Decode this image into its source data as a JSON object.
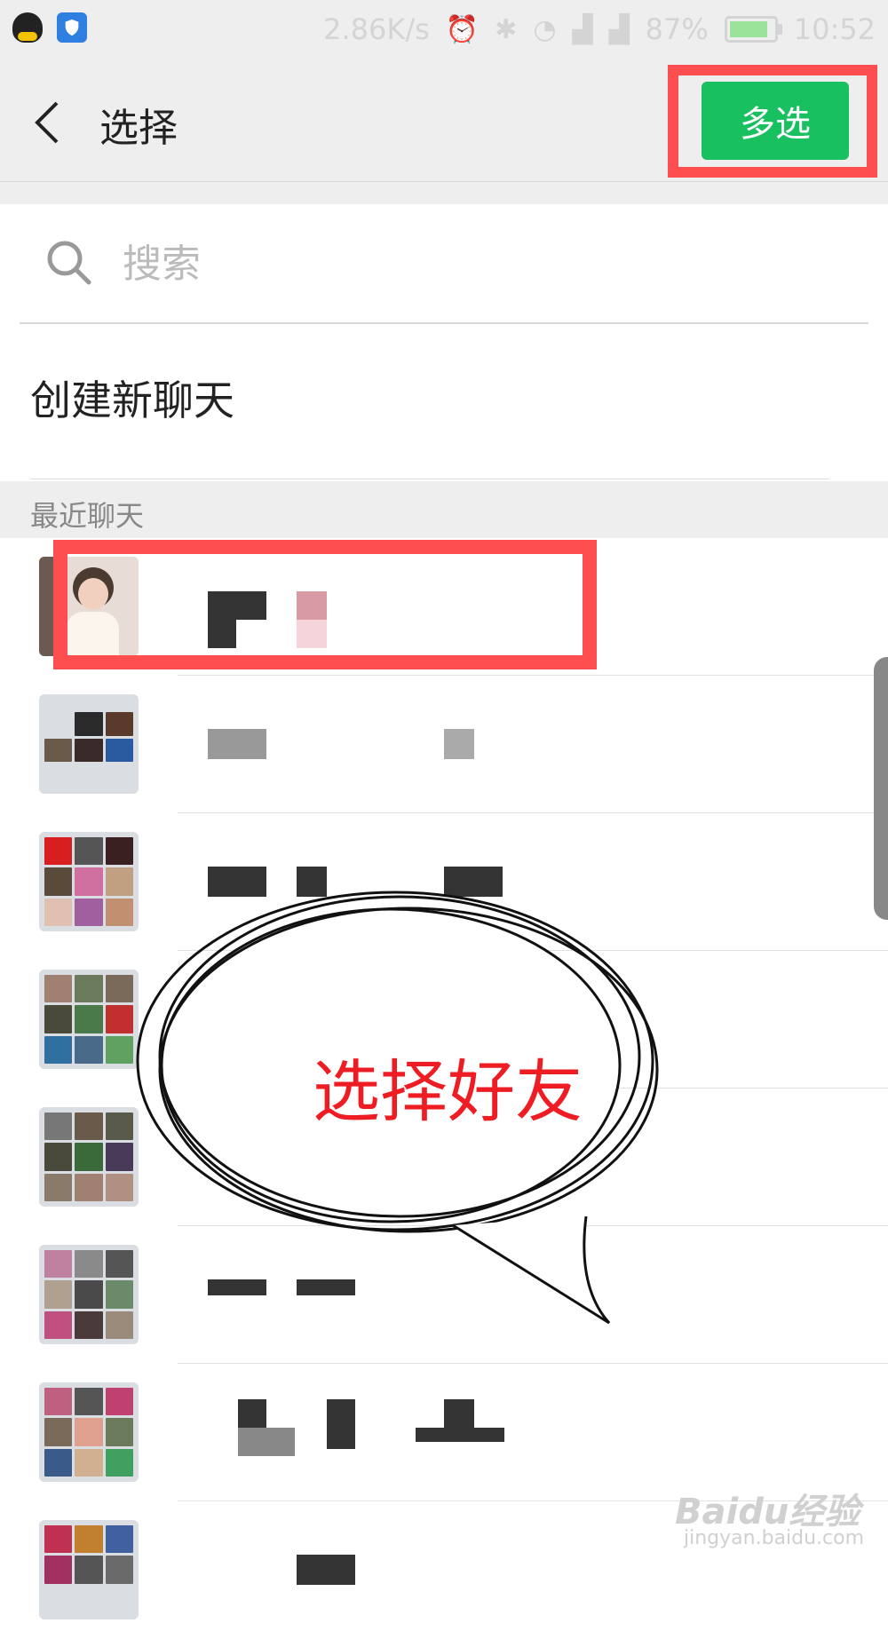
{
  "status_bar": {
    "speed": "2.86K/s",
    "battery_pct": "87%",
    "time": "10:52",
    "icons": [
      "qq-app-icon",
      "shield-app-icon",
      "alarm-icon",
      "bluetooth-icon",
      "wifi-icon",
      "signal-icon",
      "signal-icon",
      "battery-icon"
    ]
  },
  "header": {
    "title": "选择",
    "multi_select": "多选"
  },
  "search": {
    "placeholder": "搜索"
  },
  "new_chat": {
    "label": "创建新聊天"
  },
  "recent": {
    "label": "最近聊天",
    "rows": [
      {
        "avatar": "photo"
      },
      {
        "avatar": "group"
      },
      {
        "avatar": "group"
      },
      {
        "avatar": "group"
      },
      {
        "avatar": "group"
      },
      {
        "avatar": "group"
      },
      {
        "avatar": "group"
      },
      {
        "avatar": "group"
      }
    ]
  },
  "annotation": {
    "bubble_text": "选择好友"
  },
  "watermark": {
    "brand": "Baidu经验",
    "url": "jingyan.baidu.com"
  },
  "colors": {
    "accent": "#19c060",
    "highlight": "#ff4e50",
    "annotation_text": "#ee1c23"
  }
}
